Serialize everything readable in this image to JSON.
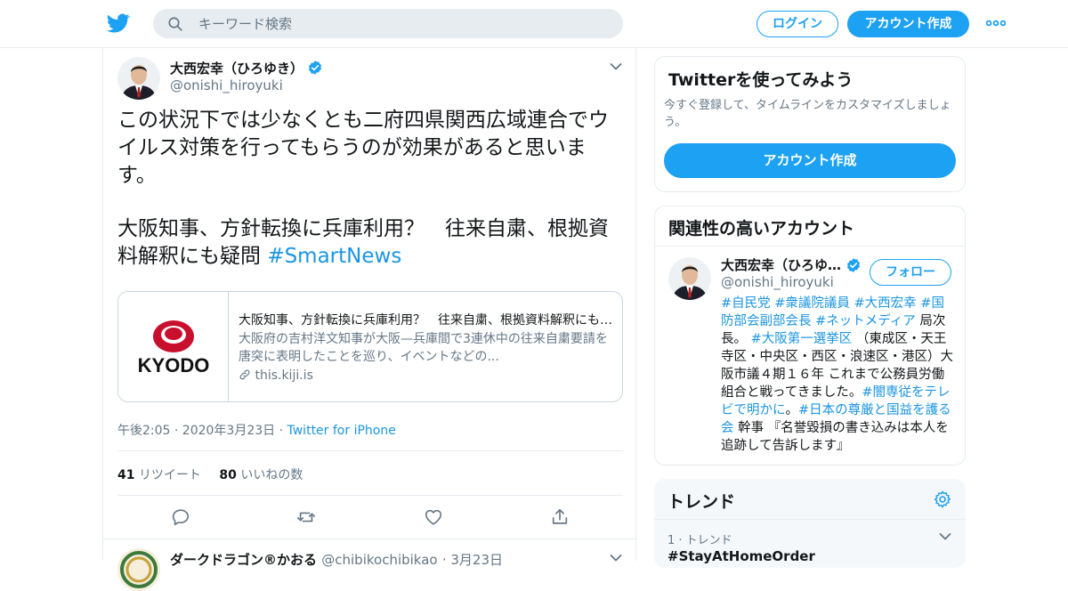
{
  "header": {
    "search_placeholder": "キーワード検索",
    "login_label": "ログイン",
    "signup_label": "アカウント作成"
  },
  "tweet": {
    "author_name": "大西宏幸（ひろゆき）",
    "author_handle": "@onishi_hiroyuki",
    "text_line1": "この状況下では少なくとも二府四県関西広域連合でウイルス対策を行ってもらうのが効果があると思います。",
    "text_line2": "大阪知事、方針転換に兵庫利用？　往来自粛、根拠資料解釈にも疑問",
    "hashtag": "#SmartNews",
    "card": {
      "logo_text": "KYODO",
      "title": "大阪知事、方針転換に兵庫利用？　往来自粛、根拠資料解釈にも疑問",
      "description": "大阪府の吉村洋文知事が大阪—兵庫間で3連休中の往来自粛要請を唐突に表明したことを巡り、イベントなどの...",
      "url": "this.kiji.is"
    },
    "timestamp": "午後2:05 · 2020年3月23日",
    "separator": " · ",
    "source": "Twitter for iPhone",
    "retweets_count": "41",
    "retweets_label": "リツイート",
    "likes_count": "80",
    "likes_label": "いいねの数"
  },
  "next_tweet": {
    "author_name": "ダークドラゴン®かおる",
    "author_handle": "@chibikochibikao",
    "date": "· 3月23日"
  },
  "sidebar": {
    "signup_panel": {
      "title": "Twitterを使ってみよう",
      "subtitle": "今すぐ登録して、タイムラインをカスタマイズしましょう。",
      "button_label": "アカウント作成"
    },
    "related_panel": {
      "title": "関連性の高いアカウント",
      "name": "大西宏幸（ひろゆき）",
      "handle": "@onishi_hiroyuki",
      "follow_label": "フォロー",
      "bio": {
        "h1": "#自民党",
        "h2": "#衆議院議員",
        "h3": "#大西宏幸",
        "h4": "#国防部会副部会長",
        "h5": "#ネットメディア",
        "t1": "局次長。",
        "h6": "#大阪第一選挙区",
        "t2": "（東成区・天王寺区・中央区・西区・浪速区・港区）大阪市議４期１６年 これまで公務員労働組合と戦ってきました。",
        "h7": "#闇専従をテレビで明かに",
        "t3": "。",
        "h8": "#日本の尊厳と国益を護る会",
        "t4": "幹事 『名誉毀損の書き込みは本人を追跡して告訴します』"
      }
    },
    "trends_panel": {
      "title": "トレンド",
      "trend_meta": "1 · トレンド",
      "trend_name": "#StayAtHomeOrder"
    }
  },
  "colors": {
    "brand_blue": "#1da1f2",
    "link_blue": "#1b95e0",
    "secondary_text": "#657786",
    "border": "#e6ecf0"
  },
  "icons": [
    "twitter-bird-icon",
    "search-icon",
    "more-dots-icon",
    "verified-badge-icon",
    "caret-down-icon",
    "reply-icon",
    "retweet-icon",
    "like-icon",
    "share-icon",
    "link-icon",
    "gear-icon"
  ]
}
